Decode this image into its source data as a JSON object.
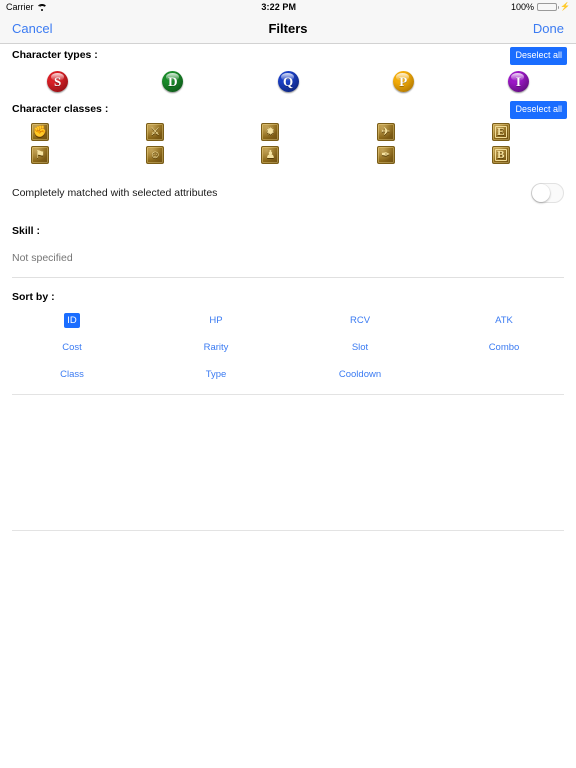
{
  "status_bar": {
    "carrier": "Carrier",
    "wifi_icon": "wifi-icon",
    "time": "3:22 PM",
    "battery_percent": "100%",
    "battery_icon": "battery-icon",
    "charging_icon": "lightning-bolt-icon"
  },
  "nav": {
    "cancel_label": "Cancel",
    "title": "Filters",
    "done_label": "Done"
  },
  "character_types": {
    "label": "Character types :",
    "deselect_label": "Deselect all",
    "orbs": [
      {
        "letter": "S",
        "name": "orb-type-s",
        "color": "#d81f26",
        "color_dark": "#7d0d11"
      },
      {
        "letter": "D",
        "name": "orb-type-d",
        "color": "#1a8a2a",
        "color_dark": "#0a4a14"
      },
      {
        "letter": "Q",
        "name": "orb-type-q",
        "color": "#1a3fc4",
        "color_dark": "#0a1c63"
      },
      {
        "letter": "P",
        "name": "orb-type-p",
        "color": "#f2ab09",
        "color_dark": "#9a6702"
      },
      {
        "letter": "I",
        "name": "orb-type-i",
        "color": "#9a18c4",
        "color_dark": "#4e0a66"
      }
    ]
  },
  "character_classes": {
    "label": "Character classes :",
    "deselect_label": "Deselect all",
    "row1": [
      {
        "name": "class-fighter",
        "glyph": "✊",
        "is_letter": false
      },
      {
        "name": "class-slasher",
        "glyph": "⚔",
        "is_letter": false
      },
      {
        "name": "class-shooter",
        "glyph": "✹",
        "is_letter": false
      },
      {
        "name": "class-striker",
        "glyph": "✈",
        "is_letter": false
      },
      {
        "name": "class-evolver",
        "glyph": "E",
        "is_letter": true
      }
    ],
    "row2": [
      {
        "name": "class-free-spirit",
        "glyph": "⚑",
        "is_letter": false
      },
      {
        "name": "class-driven",
        "glyph": "☺",
        "is_letter": false
      },
      {
        "name": "class-powerhouse",
        "glyph": "♟",
        "is_letter": false
      },
      {
        "name": "class-cerebral",
        "glyph": "✒",
        "is_letter": false
      },
      {
        "name": "class-booster",
        "glyph": "B",
        "is_letter": true
      }
    ]
  },
  "completely_matched": {
    "label": "Completely matched with selected attributes",
    "enabled": false
  },
  "skill": {
    "label": "Skill :",
    "value": "",
    "placeholder": "Not specified"
  },
  "sort_by": {
    "label": "Sort by :",
    "selected": "ID",
    "rows": [
      [
        "ID",
        "HP",
        "RCV",
        "ATK"
      ],
      [
        "Cost",
        "Rarity",
        "Slot",
        "Combo"
      ],
      [
        "Class",
        "Type",
        "Cooldown",
        ""
      ]
    ]
  },
  "colors": {
    "accent_blue": "#3b7bf2",
    "selected_blue": "#1a6dff",
    "bar_background": "#f7f7f7"
  }
}
